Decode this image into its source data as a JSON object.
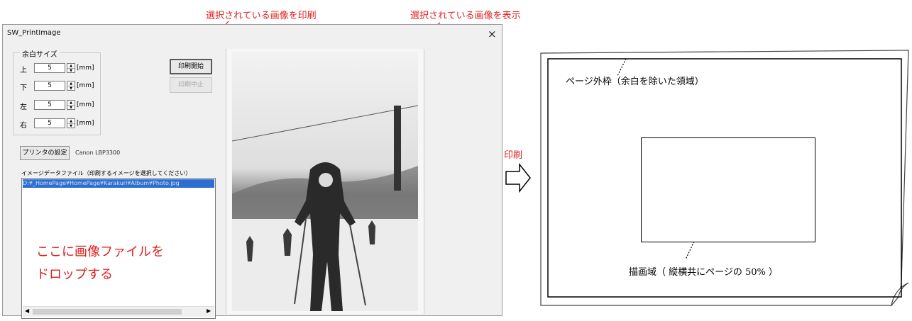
{
  "annotations": {
    "print_selected": "選択されている画像を印刷",
    "show_selected": "選択されている画像を表示",
    "print_arrow": "印刷"
  },
  "window": {
    "title": "SW_PrintImage",
    "close": "×"
  },
  "margins": {
    "title": "余白サイズ",
    "unit": "[mm]",
    "items": [
      {
        "label": "上",
        "value": "5"
      },
      {
        "label": "下",
        "value": "5"
      },
      {
        "label": "左",
        "value": "5"
      },
      {
        "label": "右",
        "value": "5"
      }
    ]
  },
  "buttons": {
    "print_start": "印刷開始",
    "print_stop": "印刷中止",
    "printer_settings": "プリンタの設定"
  },
  "printer_name": "Canon LBP3300",
  "file_list": {
    "label": "イメージデータファイル（印刷するイメージを選択してください）",
    "selected_item": "D:¥_HomePage¥HomePage¥Karakuri¥Album¥Photo.jpg",
    "drop_hint_line1": "ここに画像ファイルを",
    "drop_hint_line2": "ドロップする"
  },
  "page_diagram": {
    "frame_label": "ページ外枠（余白を除いた領域）",
    "draw_label": "描画域（ 縦横共にページの 50% ）"
  }
}
